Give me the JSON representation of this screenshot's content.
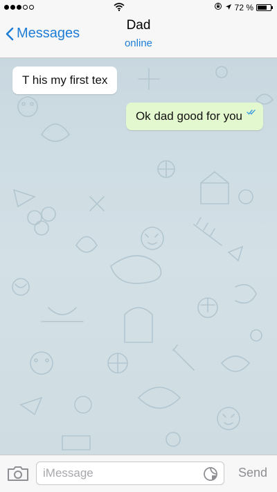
{
  "status_bar": {
    "signal_filled": 3,
    "signal_total": 5,
    "battery_text": "72 %",
    "battery_level": 0.72,
    "icons": [
      "signal-dots-icon",
      "wifi-icon",
      "lock-rotation-icon",
      "location-arrow-icon",
      "battery-icon"
    ]
  },
  "nav": {
    "back_label": "Messages",
    "title": "Dad",
    "subtitle": "online"
  },
  "messages": [
    {
      "direction": "incoming",
      "text": "T his my first tex"
    },
    {
      "direction": "outgoing",
      "text": "Ok dad good for you",
      "status": "read"
    }
  ],
  "composer": {
    "placeholder": "iMessage",
    "value": "",
    "send_label": "Send"
  },
  "colors": {
    "accent": "#1d7dd6",
    "outgoing_bubble": "#e4f8cf",
    "incoming_bubble": "#ffffff",
    "chat_background": "#cfdde3",
    "send_disabled": "#8e8e93"
  }
}
